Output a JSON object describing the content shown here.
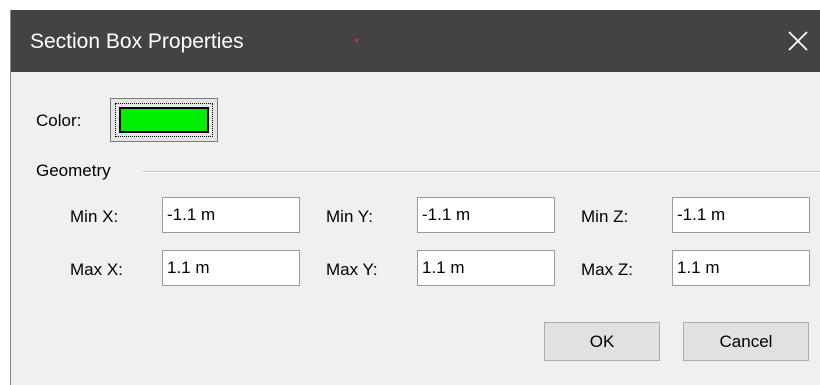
{
  "dialog": {
    "title": "Section Box Properties",
    "close_glyph": "✕"
  },
  "color": {
    "label": "Color:",
    "value": "#00ee00"
  },
  "geometry": {
    "group_label": "Geometry",
    "min_x": {
      "label": "Min X:",
      "value": "-1.1 m"
    },
    "min_y": {
      "label": "Min Y:",
      "value": "-1.1 m"
    },
    "min_z": {
      "label": "Min Z:",
      "value": "-1.1 m"
    },
    "max_x": {
      "label": "Max X:",
      "value": "1.1 m"
    },
    "max_y": {
      "label": "Max Y:",
      "value": "1.1 m"
    },
    "max_z": {
      "label": "Max Z:",
      "value": "1.1 m"
    }
  },
  "buttons": {
    "ok": "OK",
    "cancel": "Cancel"
  }
}
